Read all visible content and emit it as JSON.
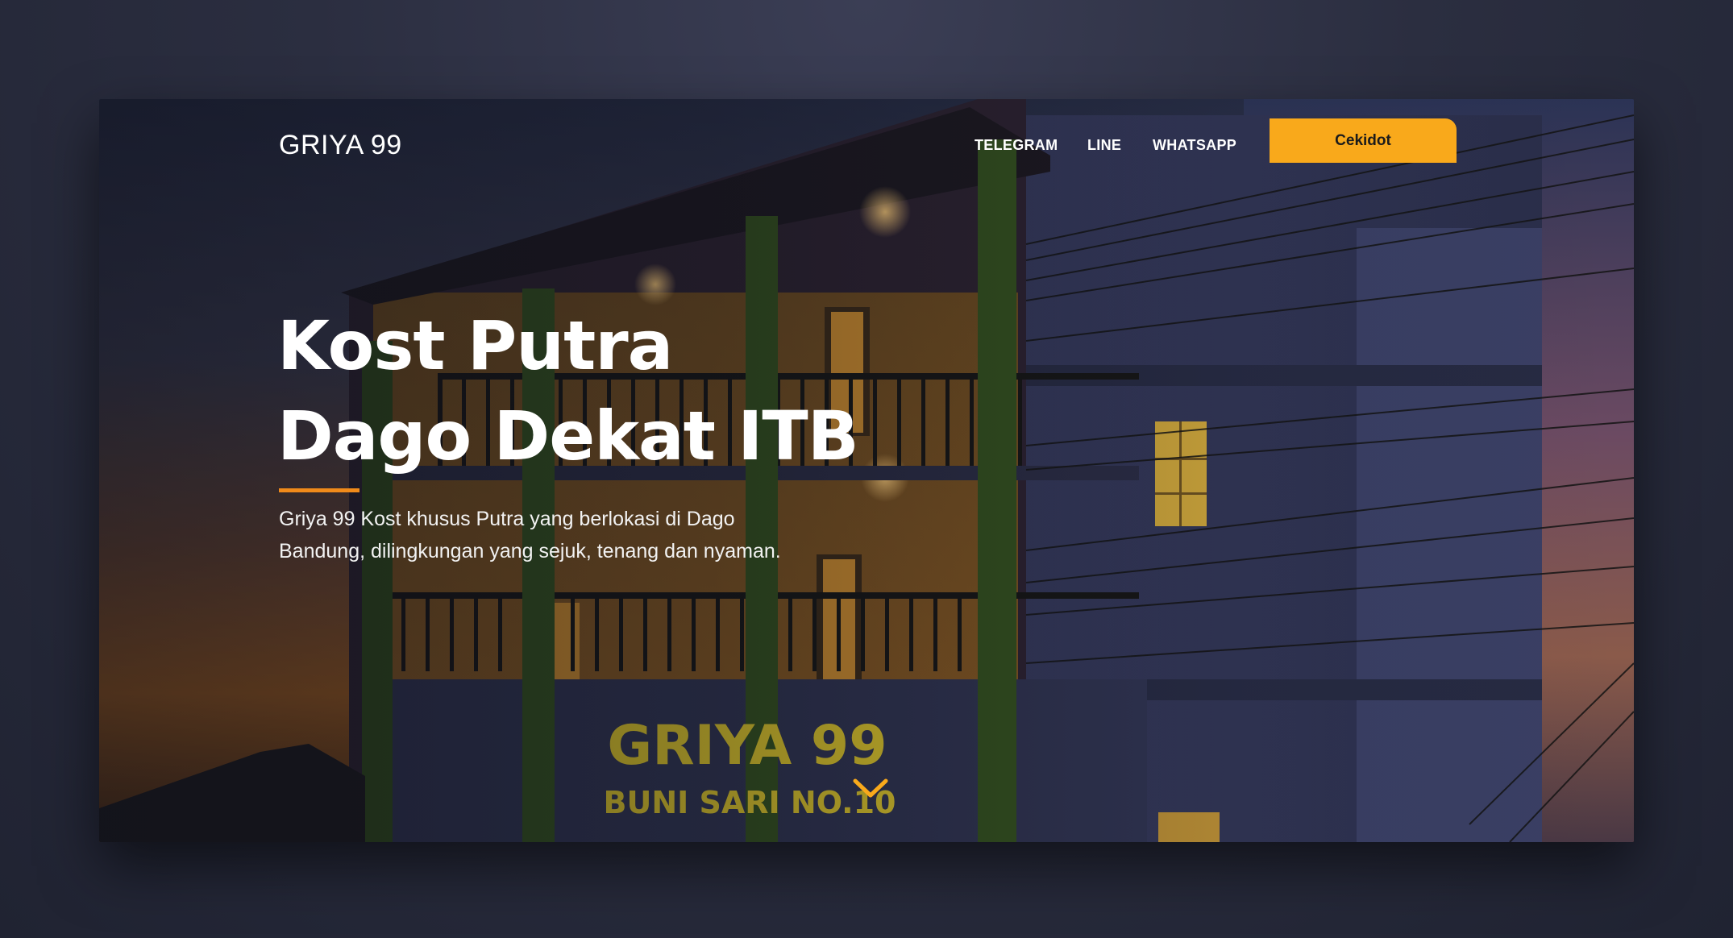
{
  "header": {
    "logo": "GRIYA 99",
    "nav": [
      {
        "label": "TELEGRAM"
      },
      {
        "label": "LINE"
      },
      {
        "label": "WHATSAPP"
      }
    ],
    "cta_label": "Cekidot"
  },
  "hero": {
    "title_line1": "Kost Putra",
    "title_line2": "Dago Dekat ITB",
    "description_line1": "Griya 99 Kost khusus Putra yang berlokasi di Dago",
    "description_line2": "Bandung, dilingkungan yang sejuk, tenang dan nyaman.",
    "background_sign_line1": "GRIYA 99",
    "background_sign_line2": "BUNI SARI NO.10"
  },
  "colors": {
    "accent": "#f9a91b",
    "accent_bar": "#f08a1a",
    "page_bg": "#2b2e40",
    "text": "#ffffff"
  },
  "icons": {
    "scroll_down": "chevron-down-icon"
  }
}
